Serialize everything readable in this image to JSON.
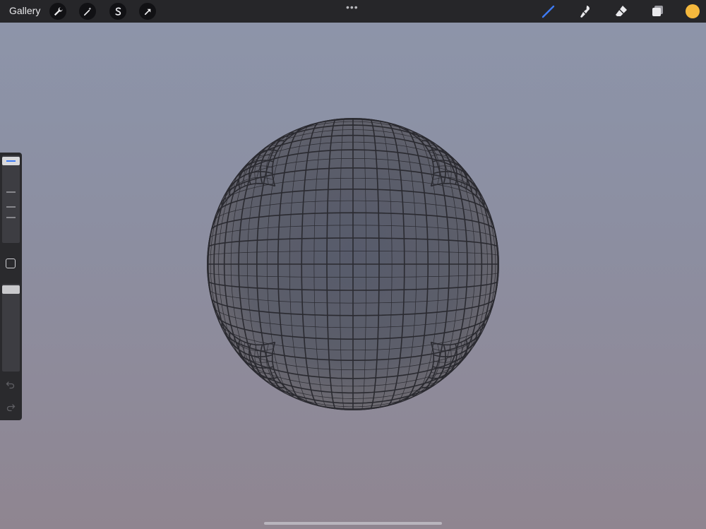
{
  "topbar": {
    "gallery_label": "Gallery",
    "left_tools": [
      "wrench-icon",
      "magic-wand-icon",
      "selection-s-icon",
      "transform-arrow-icon"
    ],
    "more_icon": "more-dots-icon",
    "right_tools": [
      "brush-icon",
      "smudge-icon",
      "eraser-icon",
      "layers-icon"
    ],
    "active_tool": "brush",
    "accent_color": "#3e7bf5",
    "current_color": "#f5b83d"
  },
  "canvas": {
    "subject": "sphere-grid",
    "background_top": "#8d95aa",
    "background_bottom": "#8f8590"
  },
  "sidebar": {
    "brush_size_level": 0.05,
    "opacity_level": 0.05
  }
}
